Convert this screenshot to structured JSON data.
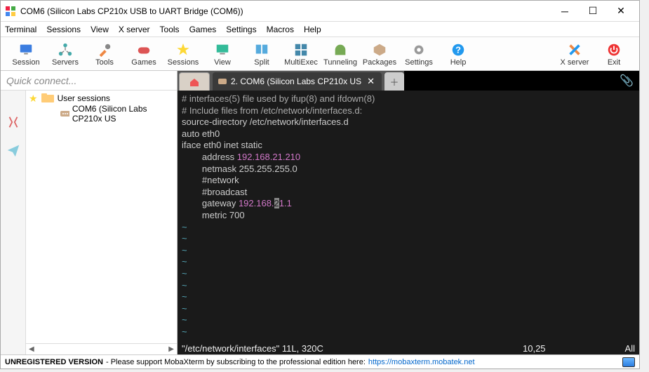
{
  "window": {
    "title": "COM6  (Silicon Labs CP210x USB to UART Bridge (COM6))"
  },
  "menubar": [
    "Terminal",
    "Sessions",
    "View",
    "X server",
    "Tools",
    "Games",
    "Settings",
    "Macros",
    "Help"
  ],
  "toolbar": [
    {
      "label": "Session",
      "name": "session-button"
    },
    {
      "label": "Servers",
      "name": "servers-button"
    },
    {
      "label": "Tools",
      "name": "tools-button"
    },
    {
      "label": "Games",
      "name": "games-button"
    },
    {
      "label": "Sessions",
      "name": "sessions-button"
    },
    {
      "label": "View",
      "name": "view-button"
    },
    {
      "label": "Split",
      "name": "split-button"
    },
    {
      "label": "MultiExec",
      "name": "multiexec-button"
    },
    {
      "label": "Tunneling",
      "name": "tunneling-button"
    },
    {
      "label": "Packages",
      "name": "packages-button"
    },
    {
      "label": "Settings",
      "name": "settings-button"
    },
    {
      "label": "Help",
      "name": "help-button"
    }
  ],
  "toolbar_right": [
    {
      "label": "X server",
      "name": "xserver-button"
    },
    {
      "label": "Exit",
      "name": "exit-button"
    }
  ],
  "quick_connect": "Quick connect...",
  "sidebar": {
    "root": "User sessions",
    "session": "COM6  (Silicon Labs CP210x US"
  },
  "tabs": {
    "active": "2. COM6  (Silicon Labs CP210x US"
  },
  "terminal": {
    "lines": [
      {
        "t": "# interfaces(5) file used by ifup(8) and ifdown(8)",
        "cls": "comment"
      },
      {
        "t": "# Include files from /etc/network/interfaces.d:",
        "cls": "comment"
      },
      {
        "t": "source-directory /etc/network/interfaces.d",
        "cls": ""
      },
      {
        "t": "auto eth0",
        "cls": ""
      },
      {
        "t": "iface eth0 inet static",
        "cls": ""
      }
    ],
    "addr_label": "        address ",
    "addr_ip": "192.168.21.210",
    "netmask": "        netmask 255.255.255.0",
    "network": "        #network",
    "broadcast": "        #broadcast",
    "gateway_label": "        gateway ",
    "gateway_pre": "192.168.",
    "gateway_cursor": "2",
    "gateway_post": "1.1",
    "metric": "        metric 700"
  },
  "status": {
    "file": "\"/etc/network/interfaces\" 11L, 320C",
    "pos": "10,25",
    "scroll": "All"
  },
  "footer": {
    "unreg": "UNREGISTERED VERSION",
    "msg": " - Please support MobaXterm by subscribing to the professional edition here: ",
    "link": "https://mobaxterm.mobatek.net"
  }
}
